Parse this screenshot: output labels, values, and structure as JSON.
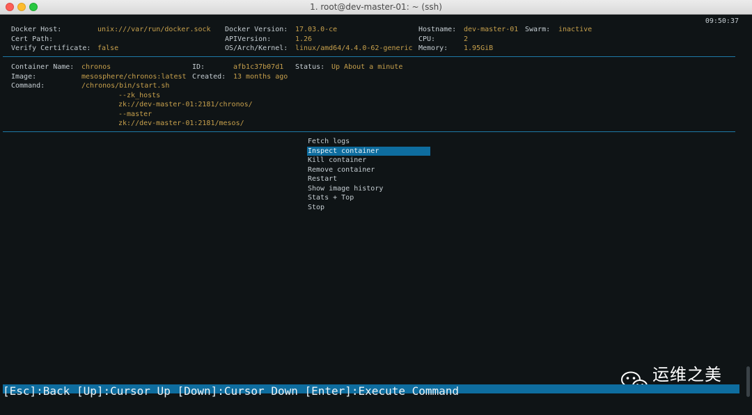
{
  "window": {
    "title": "1. root@dev-master-01: ~ (ssh)"
  },
  "clock": "09:50:37",
  "docker_info": {
    "host_label": "Docker Host:",
    "host_value": "unix:///var/run/docker.sock",
    "cert_label": "Cert Path:",
    "verify_label": "Verify Certificate:",
    "verify_value": "false",
    "version_label": "Docker Version:",
    "version_value": "17.03.0-ce",
    "api_label": "APIVersion:",
    "api_value": "1.26",
    "os_label": "OS/Arch/Kernel:",
    "os_value": "linux/amd64/4.4.0-62-generic",
    "hostname_label": "Hostname:",
    "hostname_value": "dev-master-01",
    "swarm_label": "Swarm:",
    "swarm_value": "inactive",
    "cpu_label": "CPU:",
    "cpu_value": "2",
    "memory_label": "Memory:",
    "memory_value": "1.95GiB"
  },
  "container": {
    "name_label": "Container Name:",
    "name_value": "chronos",
    "image_label": "Image:",
    "image_value": "mesosphere/chronos:latest",
    "command_label": "Command:",
    "command_lines": [
      "/chronos/bin/start.sh",
      "--zk_hosts",
      "zk://dev-master-01:2181/chronos/",
      "--master",
      "zk://dev-master-01:2181/mesos/"
    ],
    "id_label": "ID:",
    "id_value": "afb1c37b07d1",
    "created_label": "Created:",
    "created_value": "13 months ago",
    "status_label": "Status:",
    "status_value": "Up About a minute"
  },
  "menu": {
    "items": [
      "Fetch logs",
      "Inspect container",
      "Kill container",
      "Remove container",
      "Restart",
      "Show image history",
      "Stats + Top",
      "Stop"
    ],
    "selected_index": 1
  },
  "statusbar": {
    "text": "[Esc]:Back [Up]:Cursor Up [Down]:Cursor Down [Enter]:Execute Command"
  },
  "watermark": {
    "text": "运维之美",
    "icon": "wechat-icon"
  }
}
